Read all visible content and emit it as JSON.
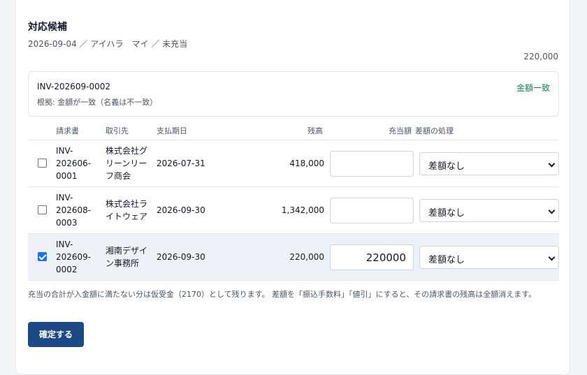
{
  "panel": {
    "title": "対応候補",
    "subtitle": "2026-09-04 ／ アイハラ　マイ ／ 未充当",
    "amount": "220,000"
  },
  "match": {
    "invoice": "INV-202609-0002",
    "basis": "根拠: 金額が一致（名義は不一致）",
    "status": "金額一致"
  },
  "table": {
    "headers": {
      "invoice": "請求書",
      "client": "取引先",
      "due": "支払期日",
      "balance": "残高",
      "allocation": "充当額",
      "diff": "差額の処理"
    },
    "rows": [
      {
        "checked": false,
        "invoice": [
          "INV-",
          "202606-",
          "0001"
        ],
        "client": [
          "株式会社グ",
          "リーンリー",
          "フ商会"
        ],
        "due": "2026-07-31",
        "balance": "418,000",
        "allocation": "",
        "diff": "差額なし"
      },
      {
        "checked": false,
        "invoice": [
          "INV-",
          "202608-",
          "0003"
        ],
        "client": [
          "株式会社ラ",
          "イトウェア"
        ],
        "due": "2026-09-30",
        "balance": "1,342,000",
        "allocation": "",
        "diff": "差額なし"
      },
      {
        "checked": true,
        "invoice": [
          "INV-",
          "202609-",
          "0002"
        ],
        "client": [
          "湘南デザイ",
          "ン事務所"
        ],
        "due": "2026-09-30",
        "balance": "220,000",
        "allocation": "220000",
        "diff": "差額なし"
      }
    ]
  },
  "note": "充当の合計が入金額に満たない分は仮受金（2170）として残ります。 差額を「振込手数料」「値引」にすると、その請求書の残高は全額消えます。",
  "confirm_label": "確定する",
  "colors": {
    "accent": "#1d4a86",
    "match_status": "#1b7f5c",
    "checkbox": "#1a73e8",
    "selected_row": "#eef2f8"
  }
}
